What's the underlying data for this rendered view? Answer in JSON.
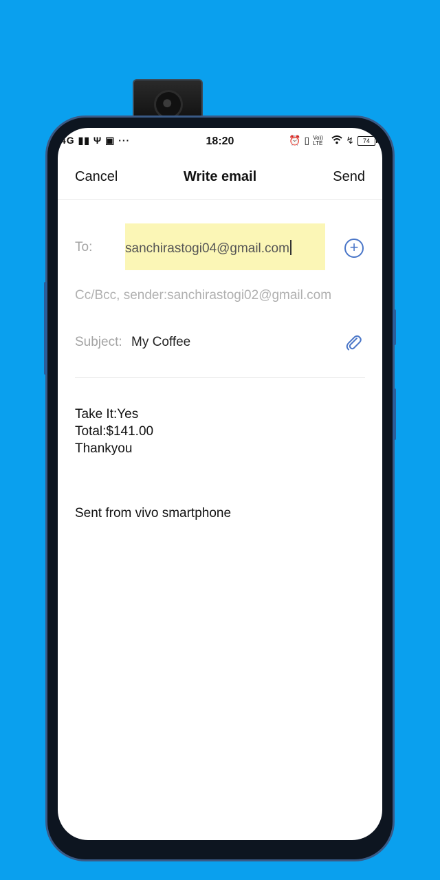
{
  "status_bar": {
    "network": "4G",
    "time": "18:20",
    "volte": "Vo)) LTE",
    "battery": "74"
  },
  "header": {
    "cancel_label": "Cancel",
    "title": "Write email",
    "send_label": "Send"
  },
  "to": {
    "label": "To:",
    "value": "sanchirastogi04@gmail.com"
  },
  "cc": {
    "text": "Cc/Bcc, sender:sanchirastogi02@gmail.com"
  },
  "subject": {
    "label": "Subject:",
    "value": "My Coffee"
  },
  "body": {
    "lines": [
      "Take It:Yes",
      "Total:$141.00",
      "Thankyou"
    ],
    "signature": "Sent from vivo smartphone"
  },
  "icons": {
    "add_recipient": "plus-circle-icon",
    "attach": "paperclip-icon"
  },
  "colors": {
    "background": "#0aa0ee",
    "highlight": "#fbf6b6",
    "accent": "#4a76c8"
  }
}
